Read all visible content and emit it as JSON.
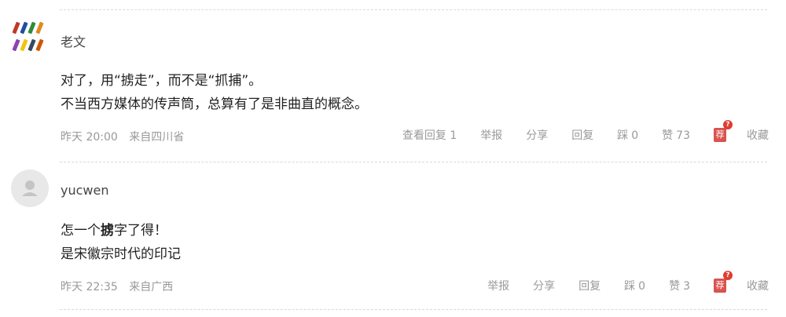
{
  "comments": [
    {
      "username": "老文",
      "lines": [
        "对了，用“掳走”，而不是“抓捕”。",
        "不当西方媒体的传声筒，总算有了是非曲直的概念。"
      ],
      "time": "昨天 20:00",
      "location": "来自四川省",
      "view_replies": "查看回复 1",
      "report": "举报",
      "share": "分享",
      "reply": "回复",
      "dislike_label": "踩",
      "dislike_count": "0",
      "like_label": "赞",
      "like_count": "73",
      "recommend": "荐",
      "recommend_badge": "?",
      "favorite": "收藏"
    },
    {
      "username": "yucwen",
      "line1_pre": "怎一个",
      "line1_bold": "掳",
      "line1_post": "字了得！",
      "line2": "是宋徽宗时代的印记",
      "time": "昨天 22:35",
      "location": "来自广西",
      "report": "举报",
      "share": "分享",
      "reply": "回复",
      "dislike_label": "踩",
      "dislike_count": "0",
      "like_label": "赞",
      "like_count": "3",
      "recommend": "荐",
      "recommend_badge": "?",
      "favorite": "收藏"
    }
  ],
  "colors": {
    "text": "#222222",
    "meta": "#999999",
    "divider": "#d8d8d8",
    "recommend_red": "#d9534f"
  }
}
